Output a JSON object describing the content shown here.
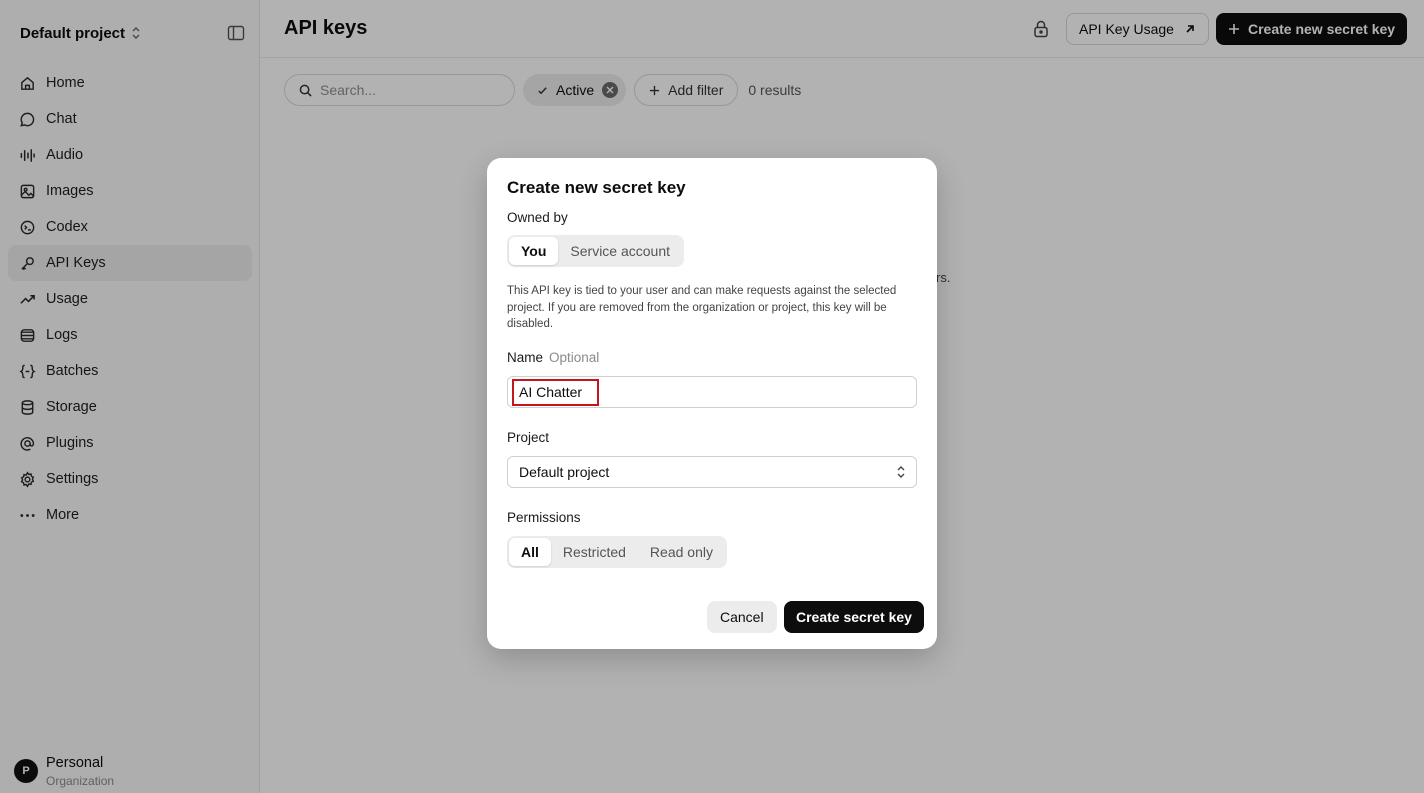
{
  "sidebar": {
    "project_name": "Default project",
    "items": [
      {
        "label": "Home",
        "icon": "home-icon"
      },
      {
        "label": "Chat",
        "icon": "chat-icon"
      },
      {
        "label": "Audio",
        "icon": "audio-waveform-icon"
      },
      {
        "label": "Images",
        "icon": "image-icon"
      },
      {
        "label": "Codex",
        "icon": "codex-icon"
      },
      {
        "label": "API Keys",
        "icon": "key-icon",
        "active": true
      },
      {
        "label": "Usage",
        "icon": "trending-up-icon"
      },
      {
        "label": "Logs",
        "icon": "logs-icon"
      },
      {
        "label": "Batches",
        "icon": "braces-icon"
      },
      {
        "label": "Storage",
        "icon": "database-icon"
      },
      {
        "label": "Plugins",
        "icon": "at-sign-icon"
      },
      {
        "label": "Settings",
        "icon": "gear-icon"
      },
      {
        "label": "More",
        "icon": "more-dots-icon"
      }
    ],
    "org": {
      "avatar_letter": "P",
      "name": "Personal",
      "subtitle": "Organization"
    }
  },
  "header": {
    "title": "API keys",
    "usage_button": "API Key Usage",
    "create_button": "Create new secret key"
  },
  "filters": {
    "search_placeholder": "Search...",
    "active_chip": "Active",
    "add_filter": "Add filter",
    "results": "0 results"
  },
  "background_fragment": "rs.",
  "modal": {
    "title": "Create new secret key",
    "owned_by_label": "Owned by",
    "owned_by_options": [
      "You",
      "Service account"
    ],
    "owned_by_selected": "You",
    "description": "This API key is tied to your user and can make requests against the selected project. If you are removed from the organization or project, this key will be disabled.",
    "name_label": "Name",
    "name_optional": "Optional",
    "name_value": "AI Chatter",
    "project_label": "Project",
    "project_value": "Default project",
    "permissions_label": "Permissions",
    "permissions_options": [
      "All",
      "Restricted",
      "Read only"
    ],
    "permissions_selected": "All",
    "cancel": "Cancel",
    "submit": "Create secret key"
  },
  "colors": {
    "primary_button": "#0d0d0d",
    "highlight_box": "#c4161c",
    "overlay": "rgba(0,0,0,0.30)"
  }
}
